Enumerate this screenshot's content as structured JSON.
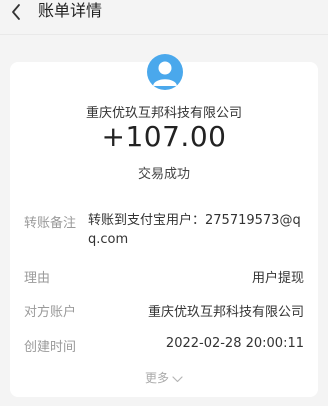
{
  "header": {
    "title": "账单详情"
  },
  "summary": {
    "merchant": "重庆优玖互邦科技有限公司",
    "amount": "+107.00",
    "status": "交易成功"
  },
  "details": [
    {
      "label": "转账备注",
      "value": "转账到支付宝用户：275719573@qq.com"
    },
    {
      "label": "理由",
      "value": "用户提现"
    },
    {
      "label": "对方账户",
      "value": "重庆优玖互邦科技有限公司"
    },
    {
      "label": "创建时间",
      "value": "2022-02-28 20:00:11"
    }
  ],
  "more_label": "更多",
  "colors": {
    "accent": "#4aa8ec",
    "background": "#f4f4f4",
    "card": "#ffffff",
    "label": "#9a9a9a"
  },
  "icons": {
    "back": "chevron-left-icon",
    "avatar": "user-avatar-icon",
    "more": "chevron-down-icon"
  }
}
